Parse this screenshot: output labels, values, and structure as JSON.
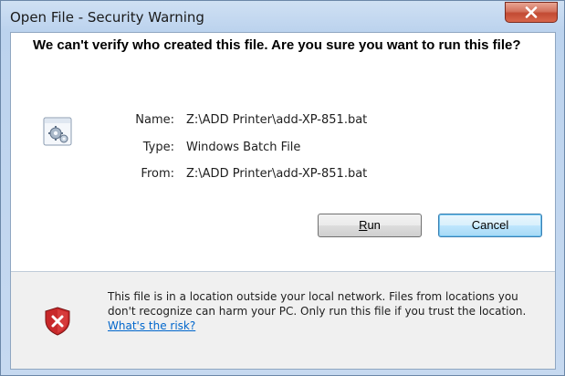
{
  "window": {
    "title": "Open File - Security Warning",
    "close_label": "X"
  },
  "dialog": {
    "headline": "We can't verify who created this file. Are you sure you want to run this file?",
    "fields": {
      "name_label": "Name:",
      "name_value": "Z:\\ADD Printer\\add-XP-851.bat",
      "type_label": "Type:",
      "type_value": "Windows Batch File",
      "from_label": "From:",
      "from_value": "Z:\\ADD Printer\\add-XP-851.bat"
    },
    "buttons": {
      "run_label_prefix": "",
      "run_label_accel": "R",
      "run_label_rest": "un",
      "cancel_label": "Cancel"
    },
    "warning": {
      "text": "This file is in a location outside your local network. Files from locations you don't recognize can harm your PC. Only run this file if you trust the location.",
      "link_text": "What's the risk?"
    }
  },
  "colors": {
    "link": "#0066cc",
    "shield": "#c8282a",
    "close_button": "#c24a33"
  },
  "icons": [
    "file-settings-icon",
    "close-icon",
    "security-shield-icon"
  ]
}
